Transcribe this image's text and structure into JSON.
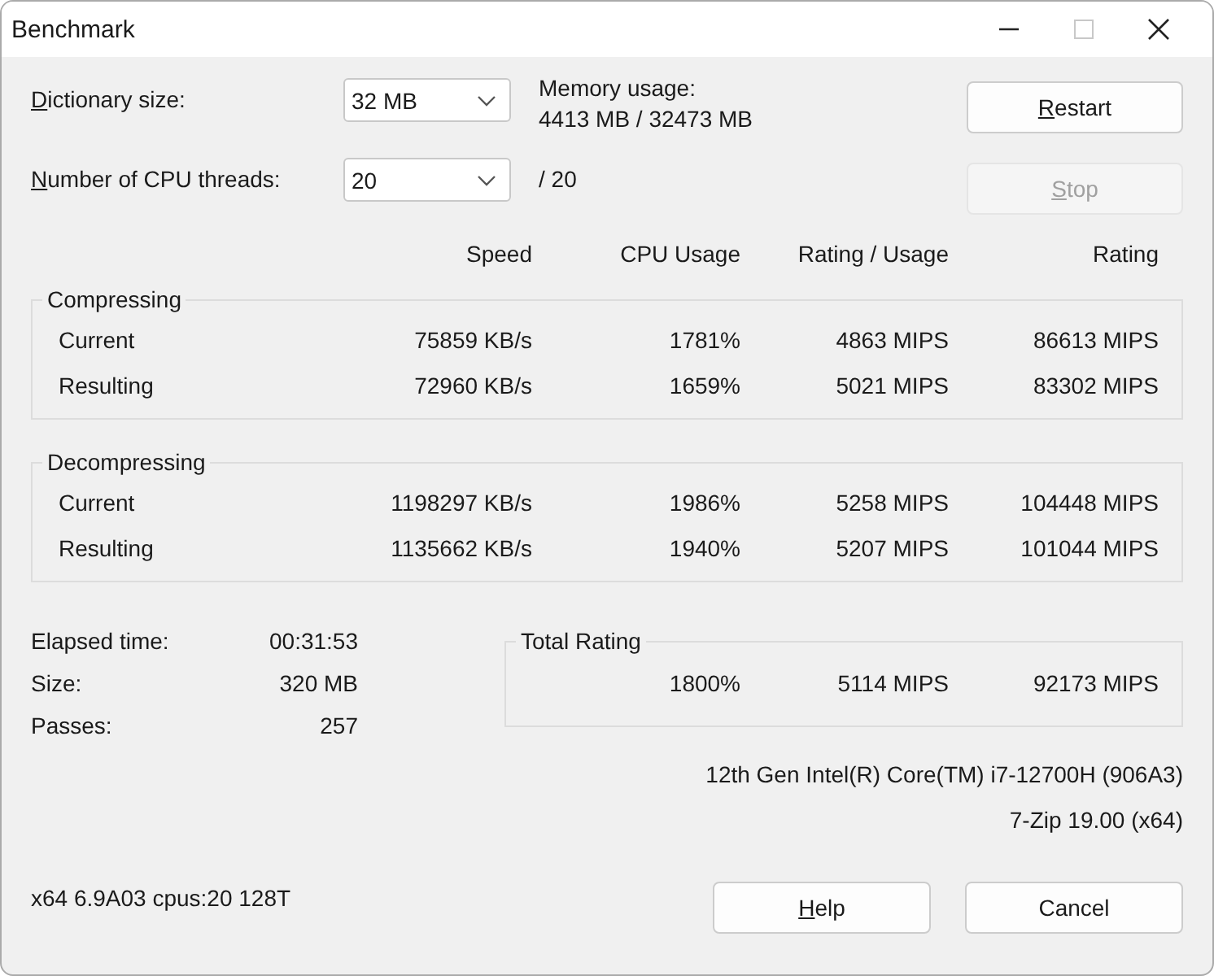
{
  "window": {
    "title": "Benchmark",
    "maximize_disabled": true
  },
  "settings": [
    {
      "label": "Dictionary size:",
      "underline_first": true,
      "value": "32 MB"
    },
    {
      "label": "Number of CPU threads:",
      "underline_first": true,
      "value": "20"
    }
  ],
  "memory": {
    "label": "Memory usage:",
    "value": "4413 MB / 32473 MB"
  },
  "threads_total": "/ 20",
  "buttons": [
    {
      "label": "Restart",
      "underline_first": true,
      "disabled": false
    },
    {
      "label": "Stop",
      "underline_first": true,
      "disabled": true
    }
  ],
  "columns": [
    "Speed",
    "CPU Usage",
    "Rating / Usage",
    "Rating"
  ],
  "groups": [
    {
      "title": "Compressing",
      "rows": [
        {
          "label": "Current",
          "cells": [
            "75859 KB/s",
            "1781%",
            "4863 MIPS",
            "86613 MIPS"
          ]
        },
        {
          "label": "Resulting",
          "cells": [
            "72960 KB/s",
            "1659%",
            "5021 MIPS",
            "83302 MIPS"
          ]
        }
      ]
    },
    {
      "title": "Decompressing",
      "rows": [
        {
          "label": "Current",
          "cells": [
            "1198297 KB/s",
            "1986%",
            "5258 MIPS",
            "104448 MIPS"
          ]
        },
        {
          "label": "Resulting",
          "cells": [
            "1135662 KB/s",
            "1940%",
            "5207 MIPS",
            "101044 MIPS"
          ]
        }
      ]
    }
  ],
  "stats": [
    {
      "label": "Elapsed time:",
      "value": "00:31:53"
    },
    {
      "label": "Size:",
      "value": "320 MB"
    },
    {
      "label": "Passes:",
      "value": "257"
    }
  ],
  "total_rating": {
    "title": "Total Rating",
    "cells": [
      "1800%",
      "5114 MIPS",
      "92173 MIPS"
    ]
  },
  "cpu": "12th Gen Intel(R) Core(TM) i7-12700H (906A3)",
  "version": "7-Zip 19.00 (x64)",
  "footer": "x64 6.9A03 cpus:20 128T",
  "dialog_buttons": [
    {
      "label": "Help",
      "underline_first": true
    },
    {
      "label": "Cancel",
      "underline_first": false
    }
  ]
}
